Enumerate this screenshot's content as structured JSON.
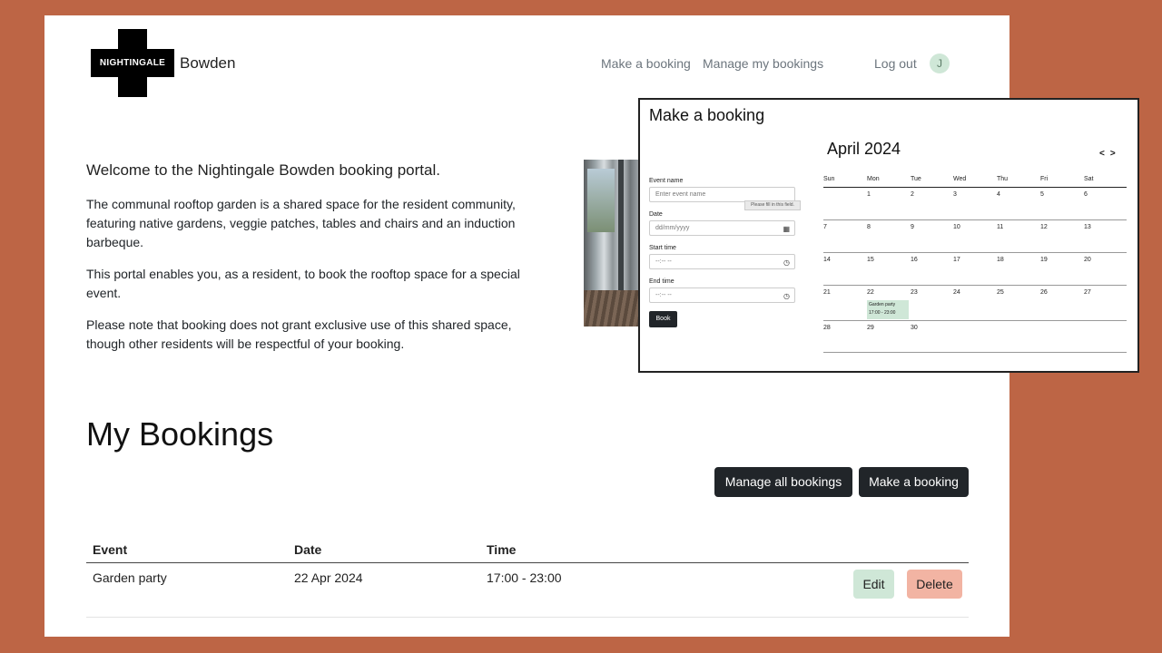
{
  "header": {
    "logo_text": "NIGHTINGALE",
    "brand": "Bowden",
    "nav": [
      "Make a booking",
      "Manage my bookings",
      "Log out"
    ],
    "avatar_initial": "J"
  },
  "intro": {
    "welcome": "Welcome to the Nightingale Bowden booking portal.",
    "paragraphs": [
      "The communal rooftop garden is a shared space for the resident community, featuring native gardens, veggie patches, tables and chairs and an induction barbeque.",
      "This portal enables you, as a resident, to book the rooftop space for a special event.",
      "Please note that booking does not grant exclusive use of this shared space, though other residents will be respectful of your booking."
    ]
  },
  "bookings": {
    "heading": "My Bookings",
    "manage_all_label": "Manage all bookings",
    "make_label": "Make a booking",
    "columns": [
      "Event",
      "Date",
      "Time"
    ],
    "rows": [
      {
        "event": "Garden party",
        "date": "22 Apr 2024",
        "time": "17:00 - 23:00",
        "edit": "Edit",
        "delete": "Delete"
      }
    ]
  },
  "booking_form": {
    "title": "Make a booking",
    "event_name_label": "Event name",
    "event_name_placeholder": "Enter event name",
    "validation_tooltip": "Please fill in this field.",
    "date_label": "Date",
    "date_placeholder": "dd/mm/yyyy",
    "start_label": "Start time",
    "start_placeholder": "--:-- --",
    "end_label": "End time",
    "end_placeholder": "--:-- --",
    "book_label": "Book",
    "calendar": {
      "month": "April 2024",
      "prev": "<",
      "next": ">",
      "weekdays": [
        "Sun",
        "Mon",
        "Tue",
        "Wed",
        "Thu",
        "Fri",
        "Sat"
      ],
      "weeks": [
        [
          "",
          "1",
          "2",
          "3",
          "4",
          "5",
          "6"
        ],
        [
          "7",
          "8",
          "9",
          "10",
          "11",
          "12",
          "13"
        ],
        [
          "14",
          "15",
          "16",
          "17",
          "18",
          "19",
          "20"
        ],
        [
          "21",
          "22",
          "23",
          "24",
          "25",
          "26",
          "27"
        ],
        [
          "28",
          "29",
          "30",
          "",
          "",
          "",
          ""
        ]
      ],
      "event_name": "Garden party",
      "event_time": "17:00 - 23:00"
    }
  },
  "colors": {
    "background": "#bd6545",
    "dark_button": "#212529",
    "edit_button": "#cfe7d7",
    "delete_button": "#f2b4a3"
  }
}
